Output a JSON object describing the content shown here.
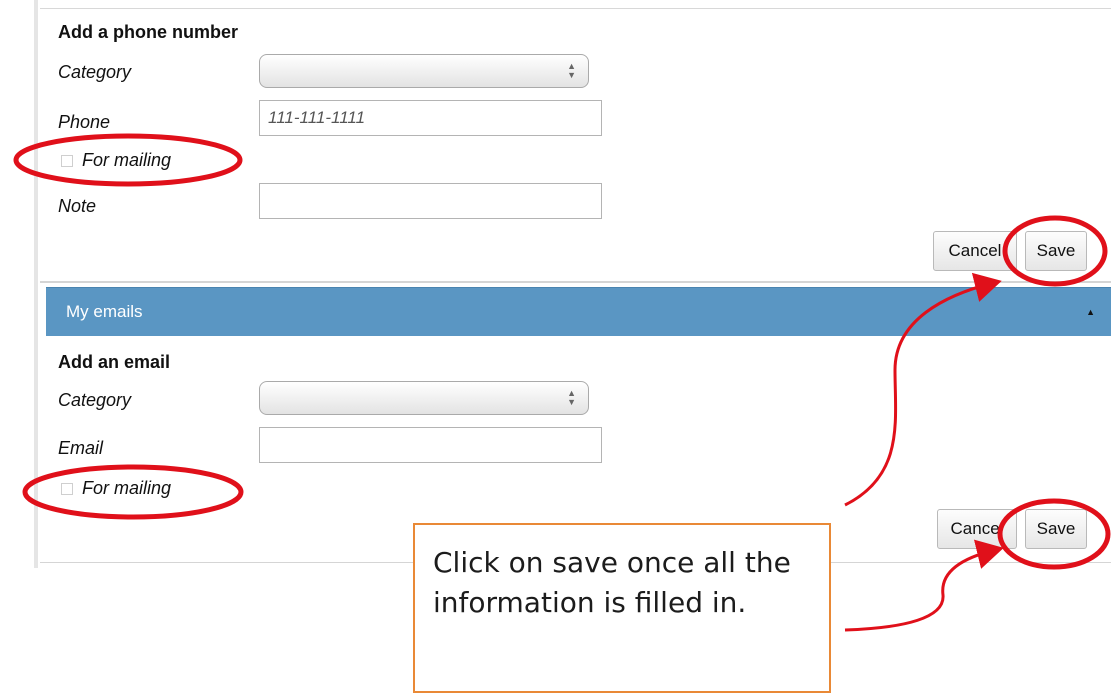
{
  "phone_form": {
    "heading": "Add a phone number",
    "category_label": "Category",
    "category_value": "",
    "phone_label": "Phone",
    "phone_placeholder": "111-111-1111",
    "for_mailing_label": "For mailing",
    "note_label": "Note",
    "cancel_label": "Cancel",
    "save_label": "Save"
  },
  "emails_section": {
    "title": "My emails",
    "caret": "▲"
  },
  "email_form": {
    "heading": "Add an email",
    "category_label": "Category",
    "category_value": "",
    "email_label": "Email",
    "for_mailing_label": "For mailing",
    "cancel_label": "Cancel",
    "save_label": "Save"
  },
  "annotation": {
    "callout_text": "Click on save once all the information is filled in.",
    "highlight_color": "#e0101a",
    "callout_border_color": "#e98936"
  }
}
